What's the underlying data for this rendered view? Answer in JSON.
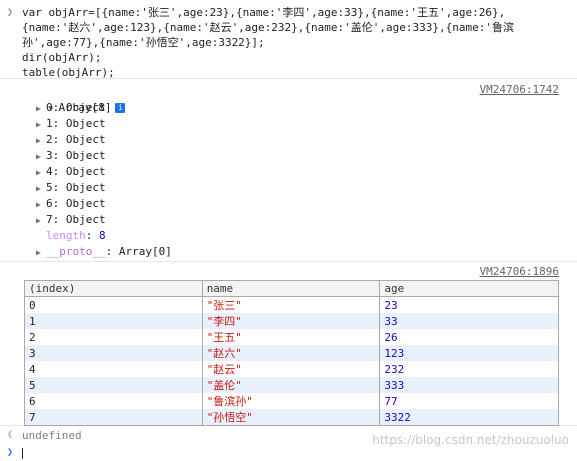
{
  "input": {
    "code_lines": [
      "var objArr=[{name:'张三',age:23},{name:'李四',age:33},{name:'王五',age:26},",
      "{name:'赵六',age:123},{name:'赵云',age:232},{name:'盖伦',age:333},{name:'鲁滨",
      "孙',age:77},{name:'孙悟空',age:3322}];",
      "dir(objArr);",
      "table(objArr);"
    ]
  },
  "dir_output": {
    "source": "VM24706:1742",
    "header": "Array[8]",
    "items": [
      "0: Object",
      "1: Object",
      "2: Object",
      "3: Object",
      "4: Object",
      "5: Object",
      "6: Object",
      "7: Object"
    ],
    "length_key": "length",
    "length_value": "8",
    "proto_key": "__proto__",
    "proto_value": "Array[0]"
  },
  "table_output": {
    "source": "VM24706:1896",
    "columns": [
      "(index)",
      "name",
      "age"
    ],
    "rows": [
      [
        "0",
        "\"张三\"",
        "23"
      ],
      [
        "1",
        "\"李四\"",
        "33"
      ],
      [
        "2",
        "\"王五\"",
        "26"
      ],
      [
        "3",
        "\"赵六\"",
        "123"
      ],
      [
        "4",
        "\"赵云\"",
        "232"
      ],
      [
        "5",
        "\"盖伦\"",
        "333"
      ],
      [
        "6",
        "\"鲁滨孙\"",
        "77"
      ],
      [
        "7",
        "\"孙悟空\"",
        "3322"
      ]
    ]
  },
  "result": {
    "text": "undefined"
  },
  "watermark": "https://blog.csdn.net/zhouzuoluo"
}
